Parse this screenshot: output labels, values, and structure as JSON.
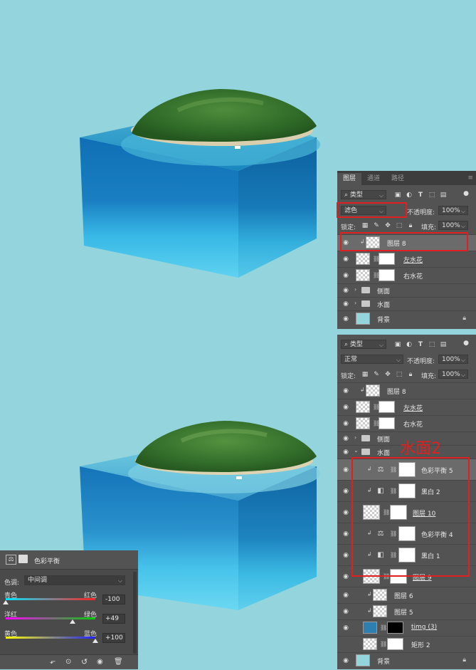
{
  "panel1": {
    "tabs": [
      "图层",
      "通道",
      "路径"
    ],
    "filter_label": "类型",
    "blend_mode": "滤色",
    "opacity_label": "不透明度:",
    "opacity_value": "100%",
    "lock_label": "锁定:",
    "fill_label": "填充:",
    "fill_value": "100%",
    "layers": [
      {
        "name": "图层 8",
        "kind": "clip-layer",
        "selected": true,
        "underline": false
      },
      {
        "name": "左水花",
        "kind": "masked",
        "selected": false,
        "underline": true
      },
      {
        "name": "右水花",
        "kind": "masked",
        "selected": false,
        "underline": false
      },
      {
        "name": "侧面",
        "kind": "group",
        "selected": false,
        "underline": false
      },
      {
        "name": "水面",
        "kind": "group",
        "selected": false,
        "underline": false
      },
      {
        "name": "背景",
        "kind": "background",
        "selected": false,
        "underline": false
      }
    ]
  },
  "panel2": {
    "filter_label": "类型",
    "blend_mode": "正常",
    "opacity_label": "不透明度:",
    "opacity_value": "100%",
    "lock_label": "锁定:",
    "fill_label": "填充:",
    "fill_value": "100%",
    "annotation": "水面2",
    "layers": [
      {
        "name": "图层 8",
        "kind": "clip-layer"
      },
      {
        "name": "左水花",
        "kind": "masked",
        "underline": true
      },
      {
        "name": "右水花",
        "kind": "masked"
      },
      {
        "name": "侧面",
        "kind": "group"
      },
      {
        "name": "水面",
        "kind": "group-open"
      },
      {
        "name": "色彩平衡 5",
        "kind": "adj-balance",
        "selected": true
      },
      {
        "name": "黑白 2",
        "kind": "adj-bw"
      },
      {
        "name": "图层 10",
        "kind": "masked-clip",
        "underline": true
      },
      {
        "name": "色彩平衡 4",
        "kind": "adj-balance"
      },
      {
        "name": "黑白 1",
        "kind": "adj-bw"
      },
      {
        "name": "图层 9",
        "kind": "masked-clip",
        "underline": true
      },
      {
        "name": "图层 6",
        "kind": "clip-layer"
      },
      {
        "name": "图层 5",
        "kind": "clip-layer"
      },
      {
        "name": "timg (3)",
        "kind": "photo-mask",
        "underline": true
      },
      {
        "name": "矩形 2",
        "kind": "masked-clip"
      },
      {
        "name": "背景",
        "kind": "background"
      }
    ]
  },
  "properties": {
    "title": "色彩平衡",
    "tone_label": "色调:",
    "tone_value": "中间调",
    "sliders": [
      {
        "left": "青色",
        "right": "红色",
        "value": "-100",
        "position": 0.0,
        "gradient": [
          "#00e5ff",
          "#ff2020"
        ]
      },
      {
        "left": "洋红",
        "right": "绿色",
        "value": "+49",
        "position": 0.745,
        "gradient": [
          "#ff00ff",
          "#00d000"
        ]
      },
      {
        "left": "黄色",
        "right": "蓝色",
        "value": "+100",
        "position": 1.0,
        "gradient": [
          "#ffff00",
          "#2020ff"
        ]
      }
    ]
  },
  "colors": {
    "background": "#94d4dc",
    "panel": "#535353",
    "annotation_red": "#e02020"
  }
}
